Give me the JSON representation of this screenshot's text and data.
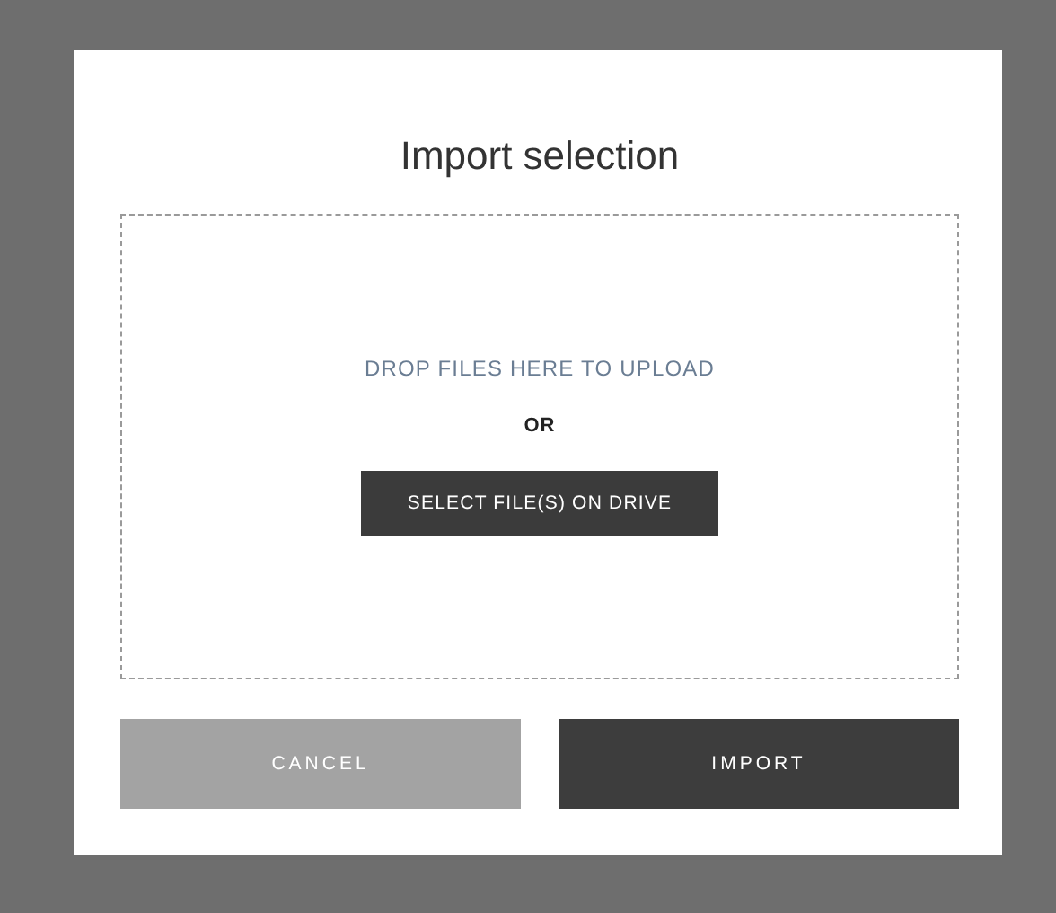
{
  "dialog": {
    "title": "Import selection",
    "dropzone": {
      "hint": "DROP FILES HERE TO UPLOAD",
      "separator": "OR",
      "button": "SELECT FILE(S) ON DRIVE"
    },
    "buttons": [
      {
        "label": "CANCEL",
        "kind": "secondary"
      },
      {
        "label": "IMPORT",
        "kind": "primary"
      }
    ]
  }
}
